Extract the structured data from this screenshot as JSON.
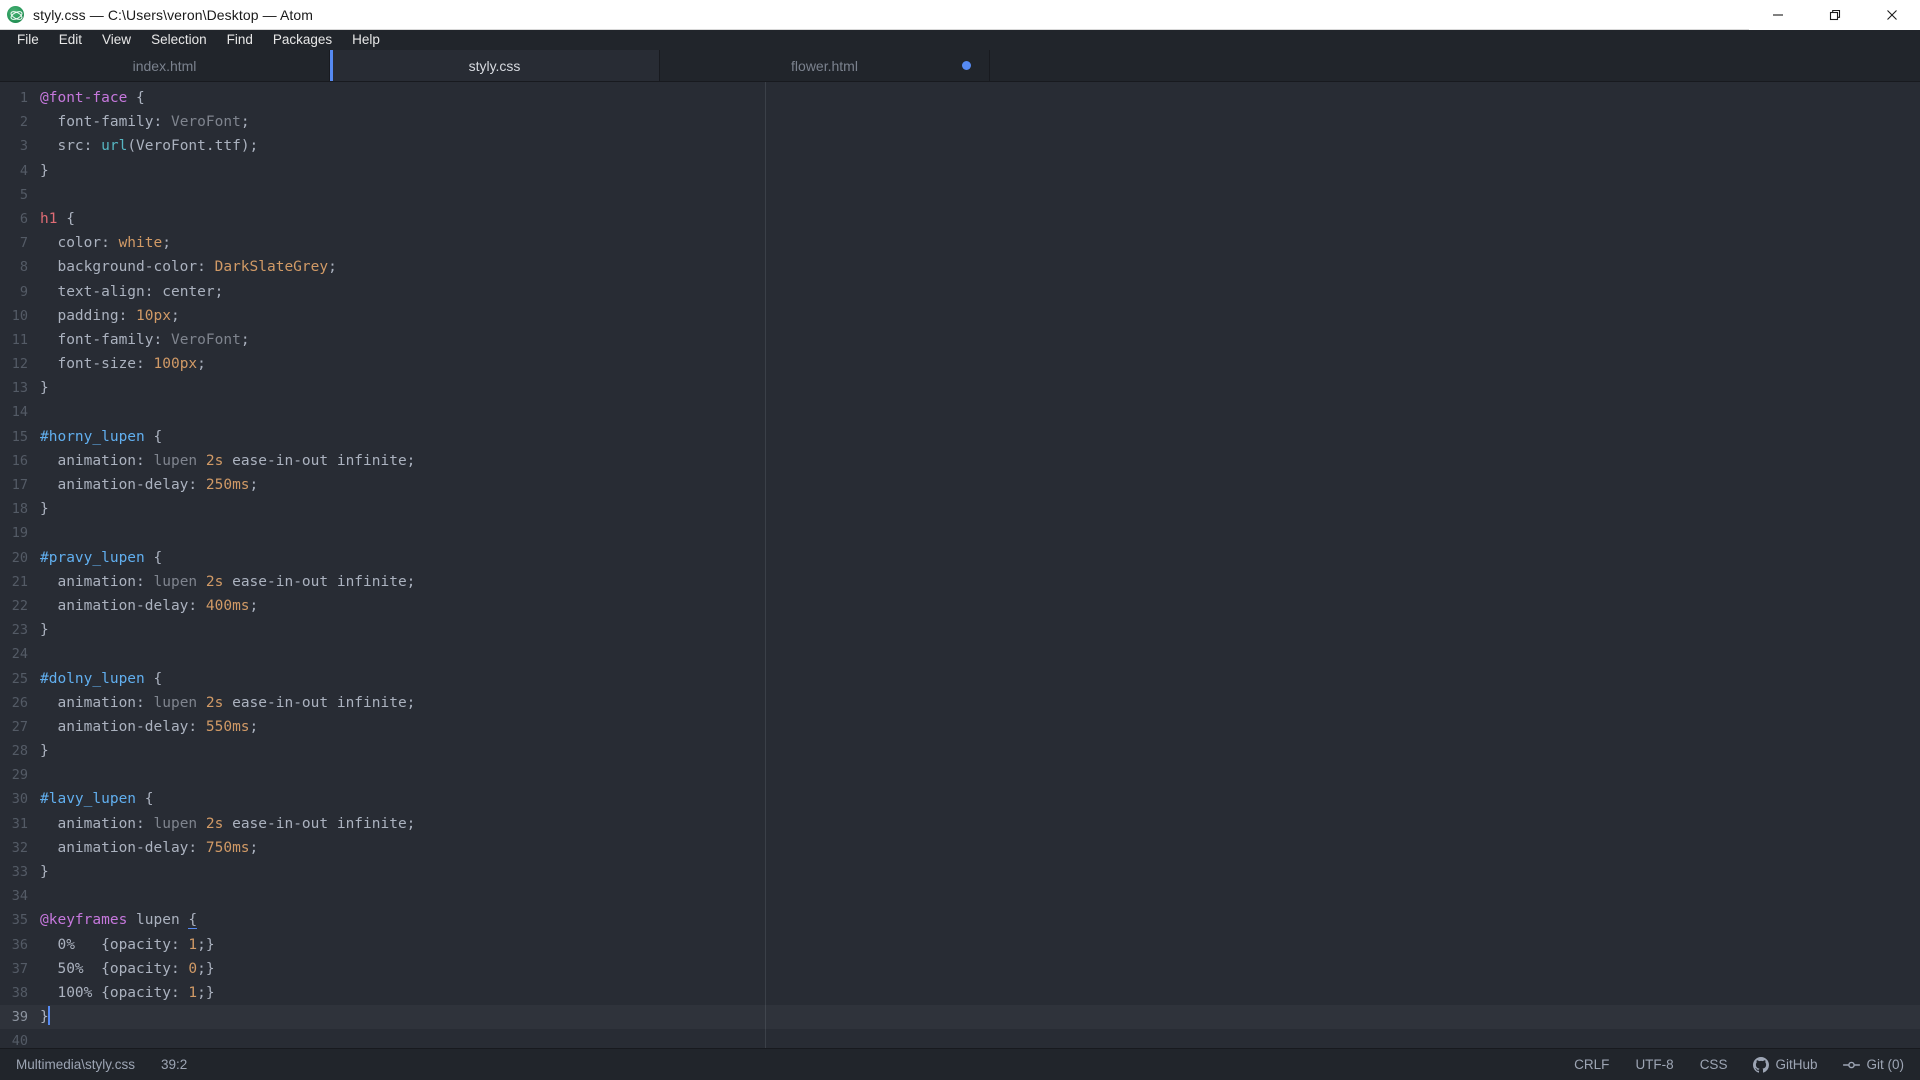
{
  "window": {
    "title": "styly.css — C:\\Users\\veron\\Desktop — Atom",
    "app_icon": "atom-logo-icon",
    "controls": [
      {
        "name": "minimize-button",
        "icon": "minimize-icon"
      },
      {
        "name": "restore-button",
        "icon": "restore-icon"
      },
      {
        "name": "close-button",
        "icon": "close-icon"
      }
    ]
  },
  "menubar": {
    "items": [
      {
        "label": "File"
      },
      {
        "label": "Edit"
      },
      {
        "label": "View"
      },
      {
        "label": "Selection"
      },
      {
        "label": "Find"
      },
      {
        "label": "Packages"
      },
      {
        "label": "Help"
      }
    ]
  },
  "tabs": [
    {
      "label": "index.html",
      "active": false,
      "modified": false
    },
    {
      "label": "styly.css",
      "active": true,
      "modified": false
    },
    {
      "label": "flower.html",
      "active": false,
      "modified": true
    }
  ],
  "editor": {
    "language": "CSS",
    "ruler_column": 80,
    "cursor_line": 39,
    "cursor_column": 2,
    "lines": [
      {
        "n": "1",
        "tokens": [
          {
            "t": "@font-face",
            "c": "t-at"
          },
          {
            "t": " {",
            "c": "t-punc"
          }
        ]
      },
      {
        "n": "2",
        "tokens": [
          {
            "t": "  font-family",
            "c": "t-prop"
          },
          {
            "t": ": ",
            "c": "t-punc"
          },
          {
            "t": "VeroFont",
            "c": "t-dim"
          },
          {
            "t": ";",
            "c": "t-punc"
          }
        ]
      },
      {
        "n": "3",
        "tokens": [
          {
            "t": "  src",
            "c": "t-prop"
          },
          {
            "t": ": ",
            "c": "t-punc"
          },
          {
            "t": "url",
            "c": "t-func"
          },
          {
            "t": "(VeroFont.ttf);",
            "c": "t-val"
          }
        ]
      },
      {
        "n": "4",
        "tokens": [
          {
            "t": "}",
            "c": "t-punc"
          }
        ]
      },
      {
        "n": "5",
        "tokens": []
      },
      {
        "n": "6",
        "tokens": [
          {
            "t": "h1",
            "c": "t-sel-tag"
          },
          {
            "t": " {",
            "c": "t-punc"
          }
        ]
      },
      {
        "n": "7",
        "tokens": [
          {
            "t": "  color",
            "c": "t-prop"
          },
          {
            "t": ": ",
            "c": "t-punc"
          },
          {
            "t": "white",
            "c": "t-num"
          },
          {
            "t": ";",
            "c": "t-punc"
          }
        ]
      },
      {
        "n": "8",
        "tokens": [
          {
            "t": "  background-color",
            "c": "t-prop"
          },
          {
            "t": ": ",
            "c": "t-punc"
          },
          {
            "t": "DarkSlateGrey",
            "c": "t-num"
          },
          {
            "t": ";",
            "c": "t-punc"
          }
        ]
      },
      {
        "n": "9",
        "tokens": [
          {
            "t": "  text-align",
            "c": "t-prop"
          },
          {
            "t": ": ",
            "c": "t-punc"
          },
          {
            "t": "center",
            "c": "t-val"
          },
          {
            "t": ";",
            "c": "t-punc"
          }
        ]
      },
      {
        "n": "10",
        "tokens": [
          {
            "t": "  padding",
            "c": "t-prop"
          },
          {
            "t": ": ",
            "c": "t-punc"
          },
          {
            "t": "10px",
            "c": "t-num"
          },
          {
            "t": ";",
            "c": "t-punc"
          }
        ]
      },
      {
        "n": "11",
        "tokens": [
          {
            "t": "  font-family",
            "c": "t-prop"
          },
          {
            "t": ": ",
            "c": "t-punc"
          },
          {
            "t": "VeroFont",
            "c": "t-dim"
          },
          {
            "t": ";",
            "c": "t-punc"
          }
        ]
      },
      {
        "n": "12",
        "tokens": [
          {
            "t": "  font-size",
            "c": "t-prop"
          },
          {
            "t": ": ",
            "c": "t-punc"
          },
          {
            "t": "100px",
            "c": "t-num"
          },
          {
            "t": ";",
            "c": "t-punc"
          }
        ]
      },
      {
        "n": "13",
        "tokens": [
          {
            "t": "}",
            "c": "t-punc"
          }
        ]
      },
      {
        "n": "14",
        "tokens": []
      },
      {
        "n": "15",
        "tokens": [
          {
            "t": "#horny_lupen",
            "c": "t-sel-id"
          },
          {
            "t": " {",
            "c": "t-punc"
          }
        ]
      },
      {
        "n": "16",
        "tokens": [
          {
            "t": "  animation",
            "c": "t-prop"
          },
          {
            "t": ": ",
            "c": "t-punc"
          },
          {
            "t": "lupen ",
            "c": "t-dim"
          },
          {
            "t": "2s",
            "c": "t-num"
          },
          {
            "t": " ease-in-out infinite;",
            "c": "t-val"
          }
        ]
      },
      {
        "n": "17",
        "tokens": [
          {
            "t": "  animation-delay",
            "c": "t-prop"
          },
          {
            "t": ": ",
            "c": "t-punc"
          },
          {
            "t": "250ms",
            "c": "t-num"
          },
          {
            "t": ";",
            "c": "t-punc"
          }
        ]
      },
      {
        "n": "18",
        "tokens": [
          {
            "t": "}",
            "c": "t-punc"
          }
        ]
      },
      {
        "n": "19",
        "tokens": []
      },
      {
        "n": "20",
        "tokens": [
          {
            "t": "#pravy_lupen",
            "c": "t-sel-id"
          },
          {
            "t": " {",
            "c": "t-punc"
          }
        ]
      },
      {
        "n": "21",
        "tokens": [
          {
            "t": "  animation",
            "c": "t-prop"
          },
          {
            "t": ": ",
            "c": "t-punc"
          },
          {
            "t": "lupen ",
            "c": "t-dim"
          },
          {
            "t": "2s",
            "c": "t-num"
          },
          {
            "t": " ease-in-out infinite;",
            "c": "t-val"
          }
        ]
      },
      {
        "n": "22",
        "tokens": [
          {
            "t": "  animation-delay",
            "c": "t-prop"
          },
          {
            "t": ": ",
            "c": "t-punc"
          },
          {
            "t": "400ms",
            "c": "t-num"
          },
          {
            "t": ";",
            "c": "t-punc"
          }
        ]
      },
      {
        "n": "23",
        "tokens": [
          {
            "t": "}",
            "c": "t-punc"
          }
        ]
      },
      {
        "n": "24",
        "tokens": []
      },
      {
        "n": "25",
        "tokens": [
          {
            "t": "#dolny_lupen",
            "c": "t-sel-id"
          },
          {
            "t": " {",
            "c": "t-punc"
          }
        ]
      },
      {
        "n": "26",
        "tokens": [
          {
            "t": "  animation",
            "c": "t-prop"
          },
          {
            "t": ": ",
            "c": "t-punc"
          },
          {
            "t": "lupen ",
            "c": "t-dim"
          },
          {
            "t": "2s",
            "c": "t-num"
          },
          {
            "t": " ease-in-out infinite;",
            "c": "t-val"
          }
        ]
      },
      {
        "n": "27",
        "tokens": [
          {
            "t": "  animation-delay",
            "c": "t-prop"
          },
          {
            "t": ": ",
            "c": "t-punc"
          },
          {
            "t": "550ms",
            "c": "t-num"
          },
          {
            "t": ";",
            "c": "t-punc"
          }
        ]
      },
      {
        "n": "28",
        "tokens": [
          {
            "t": "}",
            "c": "t-punc"
          }
        ]
      },
      {
        "n": "29",
        "tokens": []
      },
      {
        "n": "30",
        "tokens": [
          {
            "t": "#lavy_lupen",
            "c": "t-sel-id"
          },
          {
            "t": " {",
            "c": "t-punc"
          }
        ]
      },
      {
        "n": "31",
        "tokens": [
          {
            "t": "  animation",
            "c": "t-prop"
          },
          {
            "t": ": ",
            "c": "t-punc"
          },
          {
            "t": "lupen ",
            "c": "t-dim"
          },
          {
            "t": "2s",
            "c": "t-num"
          },
          {
            "t": " ease-in-out infinite;",
            "c": "t-val"
          }
        ]
      },
      {
        "n": "32",
        "tokens": [
          {
            "t": "  animation-delay",
            "c": "t-prop"
          },
          {
            "t": ": ",
            "c": "t-punc"
          },
          {
            "t": "750ms",
            "c": "t-num"
          },
          {
            "t": ";",
            "c": "t-punc"
          }
        ]
      },
      {
        "n": "33",
        "tokens": [
          {
            "t": "}",
            "c": "t-punc"
          }
        ]
      },
      {
        "n": "34",
        "tokens": []
      },
      {
        "n": "35",
        "tokens": [
          {
            "t": "@keyframes",
            "c": "t-at"
          },
          {
            "t": " lupen ",
            "c": "t-val"
          },
          {
            "t": "{",
            "c": "t-punc t-brace-match"
          }
        ]
      },
      {
        "n": "36",
        "tokens": [
          {
            "t": "  0%   {opacity: ",
            "c": "t-val"
          },
          {
            "t": "1",
            "c": "t-num"
          },
          {
            "t": ";}",
            "c": "t-punc"
          }
        ]
      },
      {
        "n": "37",
        "tokens": [
          {
            "t": "  50%  {opacity: ",
            "c": "t-val"
          },
          {
            "t": "0",
            "c": "t-num"
          },
          {
            "t": ";}",
            "c": "t-punc"
          }
        ]
      },
      {
        "n": "38",
        "tokens": [
          {
            "t": "  100% {opacity: ",
            "c": "t-val"
          },
          {
            "t": "1",
            "c": "t-num"
          },
          {
            "t": ";}",
            "c": "t-punc"
          }
        ]
      },
      {
        "n": "39",
        "tokens": [
          {
            "t": "}",
            "c": "t-punc"
          }
        ],
        "current": true,
        "cursor_after": true
      },
      {
        "n": "40",
        "tokens": []
      }
    ]
  },
  "statusbar": {
    "file_path": "Multimedia\\styly.css",
    "cursor_position": "39:2",
    "line_ending": "CRLF",
    "encoding": "UTF-8",
    "grammar": "CSS",
    "github_label": "GitHub",
    "git_label": "Git (0)",
    "github_icon": "github-icon",
    "git_icon": "git-branch-icon"
  },
  "colors": {
    "accent_blue": "#568af2",
    "editor_bg": "#282c34",
    "chrome_bg": "#21252b",
    "titlebar_bg": "#ffffff"
  }
}
